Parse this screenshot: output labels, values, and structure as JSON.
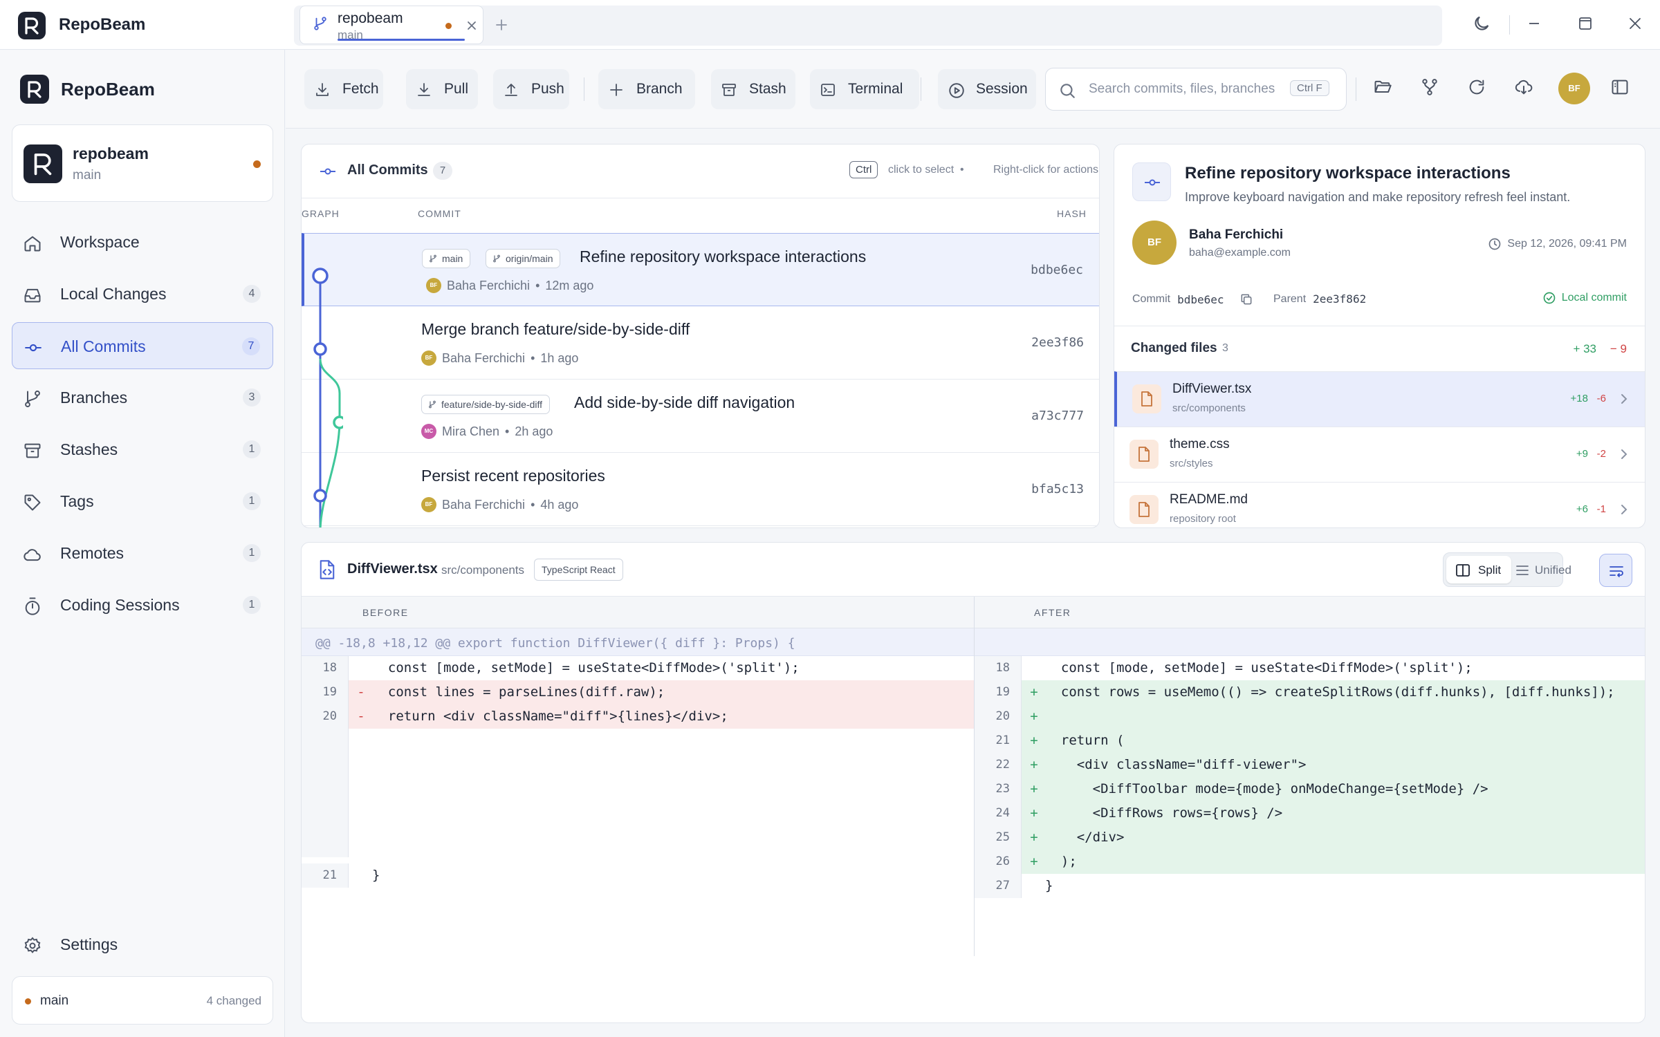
{
  "app": {
    "name": "RepoBeam"
  },
  "tab": {
    "title": "repobeam",
    "branch": "main"
  },
  "sidebar": {
    "brand": "RepoBeam",
    "repo": {
      "name": "repobeam",
      "branch": "main"
    },
    "items": [
      {
        "label": "Workspace",
        "count": "",
        "icon": "home-icon"
      },
      {
        "label": "Local Changes",
        "count": "4",
        "icon": "inbox-icon"
      },
      {
        "label": "All Commits",
        "count": "7",
        "icon": "commit-icon",
        "active": true
      },
      {
        "label": "Branches",
        "count": "3",
        "icon": "branch-icon"
      },
      {
        "label": "Stashes",
        "count": "1",
        "icon": "archive-icon"
      },
      {
        "label": "Tags",
        "count": "1",
        "icon": "tag-icon"
      },
      {
        "label": "Remotes",
        "count": "1",
        "icon": "cloud-icon"
      },
      {
        "label": "Coding Sessions",
        "count": "1",
        "icon": "timer-icon"
      }
    ],
    "settings": "Settings",
    "footer": {
      "branch": "main",
      "changed": "4 changed"
    }
  },
  "toolbar": {
    "fetch": "Fetch",
    "pull": "Pull",
    "push": "Push",
    "branch": "Branch",
    "stash": "Stash",
    "terminal": "Terminal",
    "session": "Session",
    "search_placeholder": "Search commits, files, branches",
    "search_shortcut": "Ctrl F",
    "avatar": "BF"
  },
  "commits": {
    "title": "All Commits",
    "count": "7",
    "hint_key": "Ctrl",
    "hint_select": "click to select",
    "hint_sep": "•",
    "hint_actions": "Right-click for actions",
    "col_graph": "GRAPH",
    "col_commit": "COMMIT",
    "col_hash": "HASH",
    "rows": [
      {
        "refs": [
          "main",
          "origin/main"
        ],
        "message": "Refine repository workspace interactions",
        "author": "Baha Ferchichi",
        "initials": "BF",
        "time": "12m ago",
        "hash": "bdbe6ec",
        "selected": true
      },
      {
        "refs": [],
        "message": "Merge branch feature/side-by-side-diff",
        "author": "Baha Ferchichi",
        "initials": "BF",
        "time": "1h ago",
        "hash": "2ee3f86"
      },
      {
        "refs": [
          "feature/side-by-side-diff"
        ],
        "message": "Add side-by-side diff navigation",
        "author": "Mira Chen",
        "initials": "MC",
        "time": "2h ago",
        "hash": "a73c777"
      },
      {
        "refs": [],
        "message": "Persist recent repositories",
        "author": "Baha Ferchichi",
        "initials": "BF",
        "time": "4h ago",
        "hash": "bfa5c13"
      }
    ]
  },
  "details": {
    "title": "Refine repository workspace interactions",
    "subtitle": "Improve keyboard navigation and make repository refresh feel instant.",
    "author_initials": "BF",
    "author": "Baha Ferchichi",
    "email": "baha@example.com",
    "date": "Sep 12, 2026, 09:41 PM",
    "commit_label": "Commit",
    "commit": "bdbe6ec",
    "parent_label": "Parent",
    "parent": "2ee3f862",
    "status": "Local commit",
    "changed_files_label": "Changed files",
    "changed_files_count": "3",
    "additions": "+ 33",
    "deletions": "− 9",
    "files": [
      {
        "name": "DiffViewer.tsx",
        "path": "src/components",
        "add": "+18",
        "del": "-6",
        "selected": true
      },
      {
        "name": "theme.css",
        "path": "src/styles",
        "add": "+9",
        "del": "-2"
      },
      {
        "name": "README.md",
        "path": "repository root",
        "add": "+6",
        "del": "-1"
      }
    ]
  },
  "diff": {
    "file": "DiffViewer.tsx",
    "path": "src/components",
    "language": "TypeScript React",
    "split_label": "Split",
    "unified_label": "Unified",
    "before_label": "BEFORE",
    "after_label": "AFTER",
    "hunk": "@@ -18,8 +18,12 @@ export function DiffViewer({ diff }: Props) {",
    "left": [
      {
        "n": "18",
        "mark": "",
        "code": "  const [mode, setMode] = useState<DiffMode>('split');",
        "type": "ctx"
      },
      {
        "n": "19",
        "mark": "-",
        "code": "  const lines = parseLines(diff.raw);",
        "type": "del"
      },
      {
        "n": "20",
        "mark": "-",
        "code": "  return <div className=\"diff\">{lines}</div>;",
        "type": "del"
      },
      {
        "n": "21",
        "mark": "",
        "code": "}",
        "type": "ctx"
      }
    ],
    "right": [
      {
        "n": "18",
        "mark": "",
        "code": "  const [mode, setMode] = useState<DiffMode>('split');",
        "type": "ctx"
      },
      {
        "n": "19",
        "mark": "+",
        "code": "  const rows = useMemo(() => createSplitRows(diff.hunks), [diff.hunks]);",
        "type": "add"
      },
      {
        "n": "20",
        "mark": "+",
        "code": "",
        "type": "add"
      },
      {
        "n": "21",
        "mark": "+",
        "code": "  return (",
        "type": "add"
      },
      {
        "n": "22",
        "mark": "+",
        "code": "    <div className=\"diff-viewer\">",
        "type": "add"
      },
      {
        "n": "23",
        "mark": "+",
        "code": "      <DiffToolbar mode={mode} onModeChange={setMode} />",
        "type": "add"
      },
      {
        "n": "24",
        "mark": "+",
        "code": "      <DiffRows rows={rows} />",
        "type": "add"
      },
      {
        "n": "25",
        "mark": "+",
        "code": "    </div>",
        "type": "add"
      },
      {
        "n": "26",
        "mark": "+",
        "code": "  );",
        "type": "add"
      },
      {
        "n": "27",
        "mark": "",
        "code": "}",
        "type": "ctx"
      }
    ]
  }
}
